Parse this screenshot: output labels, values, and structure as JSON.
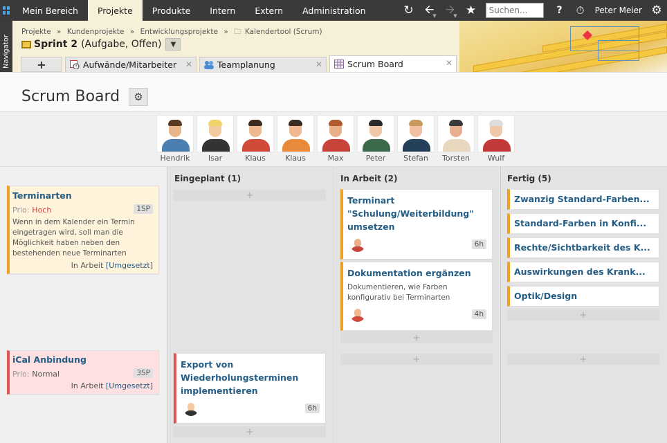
{
  "nav": {
    "items": [
      "Mein Bereich",
      "Projekte",
      "Produkte",
      "Intern",
      "Extern",
      "Administration"
    ],
    "active": 1
  },
  "toolbar": {
    "search_placeholder": "Suchen...",
    "help": "?",
    "user": "Peter Meier",
    "icons": [
      "refresh-icon",
      "back-icon",
      "forward-icon",
      "star-icon",
      "help-icon",
      "timer-icon",
      "gear-icon"
    ]
  },
  "navigator_label": "Navigator",
  "breadcrumb": [
    "Projekte",
    "»",
    "Kundenprojekte",
    "»",
    "Entwicklungsprojekte",
    "»",
    "Kalendertool (Scrum)"
  ],
  "sprint": {
    "name": "Sprint 2",
    "status": "(Aufgabe, Offen)"
  },
  "tabs": [
    {
      "label": "Aufwände/Mitarbeiter"
    },
    {
      "label": "Teamplanung"
    },
    {
      "label": "Scrum Board"
    }
  ],
  "add_tab": "+",
  "page_title": "Scrum Board",
  "team": [
    {
      "name": "Hendrik",
      "skin": "#e8b48a",
      "hair": "#5a3a25",
      "shirt": "#4a7fb0"
    },
    {
      "name": "Isar",
      "skin": "#f3c9a0",
      "hair": "#f1d36a",
      "shirt": "#333333"
    },
    {
      "name": "Klaus",
      "skin": "#f0b890",
      "hair": "#3a2a20",
      "shirt": "#d14a3a"
    },
    {
      "name": "Klaus",
      "skin": "#f0b890",
      "hair": "#3a2a20",
      "shirt": "#e88a3a"
    },
    {
      "name": "Max",
      "skin": "#e8b08a",
      "hair": "#b05a30",
      "shirt": "#c8443a"
    },
    {
      "name": "Peter",
      "skin": "#f0c8a8",
      "hair": "#2a2a2a",
      "shirt": "#3a6a4a"
    },
    {
      "name": "Stefan",
      "skin": "#f0c0a0",
      "hair": "#c99a60",
      "shirt": "#24405a"
    },
    {
      "name": "Torsten",
      "skin": "#e8b090",
      "hair": "#3a3a3a",
      "shirt": "#e8d8c0"
    },
    {
      "name": "Wulf",
      "skin": "#f0c8a8",
      "hair": "#dddddd",
      "shirt": "#c43a3a"
    }
  ],
  "columns": [
    {
      "title": "Eingeplant (1)"
    },
    {
      "title": "In Arbeit (2)"
    },
    {
      "title": "Fertig (5)"
    }
  ],
  "stories": [
    {
      "title": "Terminarten",
      "prio_label": "Prio:",
      "prio": "Hoch",
      "prio_color": "#d04040",
      "points": "1SP",
      "desc": "Wenn in dem Kalender ein Termin eingetragen wird, soll man die Möglichkeit haben neben den bestehenden neue Terminarten",
      "status": "In Arbeit",
      "link": "[Umgesetzt]"
    },
    {
      "title": "iCal Anbindung",
      "prio_label": "Prio:",
      "prio": "Normal",
      "prio_color": "#555555",
      "points": "3SP",
      "status": "In Arbeit",
      "link": "[Umgesetzt]"
    }
  ],
  "tasks": {
    "inwork": [
      {
        "title": "Terminart \"Schulung/Weiterbildung\" umsetzen",
        "hours": "6h"
      },
      {
        "title": "Dokumentation ergänzen",
        "desc": "Dokumentieren, wie Farben konfigurativ bei Terminarten",
        "hours": "4h"
      }
    ],
    "planned2": [
      {
        "title": "Export von Wiederholungsterminen implementieren",
        "hours": "6h"
      }
    ],
    "done": [
      "Zwanzig Standard-Farben...",
      "Standard-Farben in Konfi...",
      "Rechte/Sichtbarkeit des K...",
      "Auswirkungen des Krank...",
      "Optik/Design"
    ]
  },
  "add_symbol": "+"
}
